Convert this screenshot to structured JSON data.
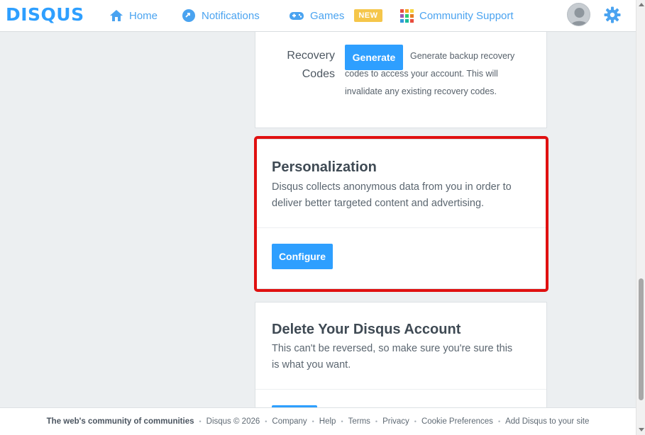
{
  "brand": {
    "logo": "DISQUS",
    "accent": "#2e9fff"
  },
  "nav": {
    "home": "Home",
    "notifications": "Notifications",
    "games": "Games",
    "games_badge": "NEW",
    "community_support": "Community Support"
  },
  "recovery": {
    "label": "Recovery Codes",
    "button": "Generate",
    "description": "Generate backup recovery codes to access your account. This will invalidate any existing recovery codes."
  },
  "personalization": {
    "title": "Personalization",
    "description": "Disqus collects anonymous data from you in order to deliver better targeted content and advertising.",
    "button": "Configure",
    "highlight_color": "#e01010"
  },
  "delete_account": {
    "title": "Delete Your Disqus Account",
    "description": "This can't be reversed, so make sure you're sure this is what you want."
  },
  "footer": {
    "tagline": "The web's community of communities",
    "copyright": "Disqus © 2026",
    "links": [
      "Company",
      "Help",
      "Terms",
      "Privacy",
      "Cookie Preferences",
      "Add Disqus to your site"
    ]
  }
}
